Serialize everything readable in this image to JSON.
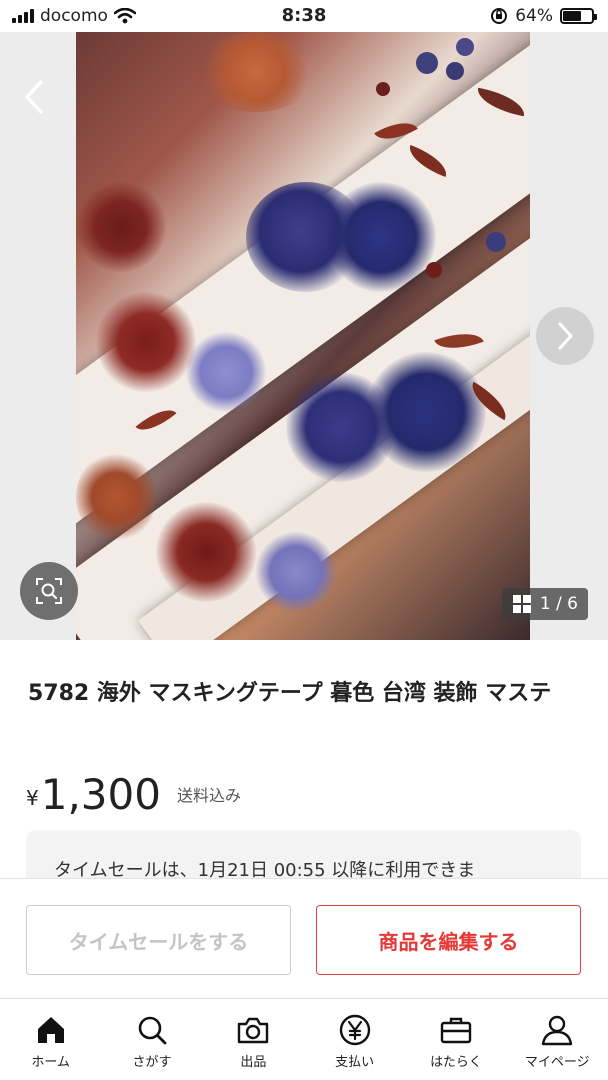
{
  "status_bar": {
    "carrier": "docomo",
    "time": "8:38",
    "battery_percent": "64%",
    "battery_level": 0.64
  },
  "gallery": {
    "counter": "1 / 6",
    "current_image": 1,
    "total_images": 6
  },
  "product": {
    "title": "5782 海外 マスキングテープ 暮色 台湾 装飾 マステ",
    "currency": "¥",
    "price": "1,300",
    "shipping": "送料込み"
  },
  "timesale_notice": "タイムセールは、1月21日 00:55 以降に利用できま",
  "actions": {
    "timesale_label": "タイムセールをする",
    "edit_label": "商品を編集する"
  },
  "tabs": [
    {
      "label": "ホーム",
      "icon": "home-icon"
    },
    {
      "label": "さがす",
      "icon": "search-icon"
    },
    {
      "label": "出品",
      "icon": "camera-icon"
    },
    {
      "label": "支払い",
      "icon": "yen-icon"
    },
    {
      "label": "はたらく",
      "icon": "briefcase-icon"
    },
    {
      "label": "マイページ",
      "icon": "person-icon"
    }
  ],
  "colors": {
    "accent": "#e53935",
    "disabled": "#c4c4c4"
  }
}
